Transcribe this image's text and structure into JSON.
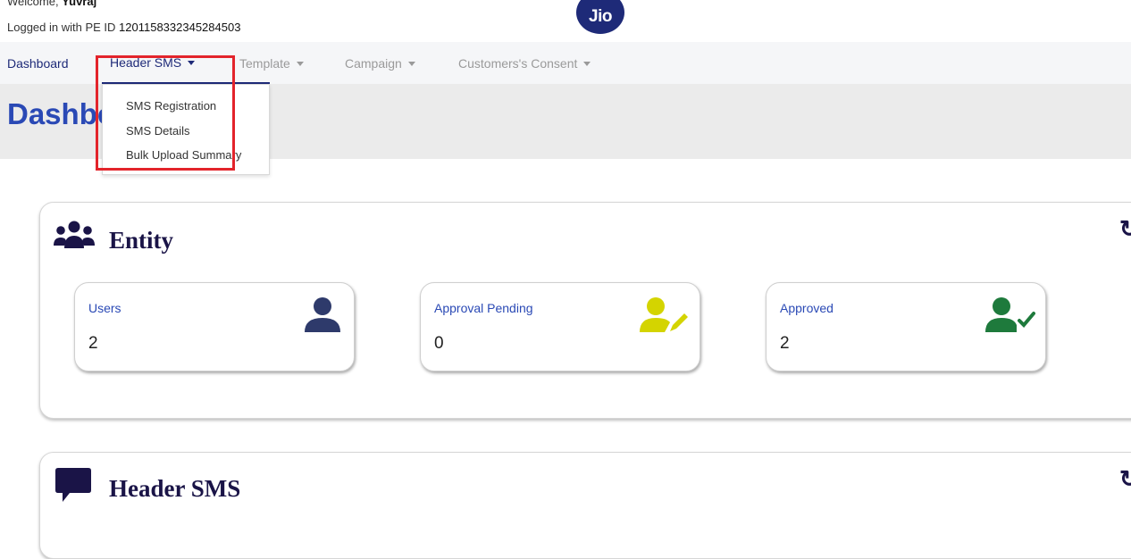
{
  "header": {
    "welcome_prefix": "Welcome, ",
    "welcome_user": "Yuvraj",
    "pe_prefix": "Logged in with PE ID ",
    "pe_id": "1201158332345284503",
    "logo_text": "Jio"
  },
  "nav": {
    "items": [
      {
        "label": "Dashboard"
      },
      {
        "label": "Header SMS"
      },
      {
        "label": "Template"
      },
      {
        "label": "Campaign"
      },
      {
        "label": "Customers's Consent"
      }
    ]
  },
  "dropdown": {
    "items": [
      {
        "label": "SMS Registration"
      },
      {
        "label": "SMS Details"
      },
      {
        "label": "Bulk Upload Summary"
      }
    ]
  },
  "page": {
    "title": "Dashboard"
  },
  "sections": {
    "entity": {
      "title": "Entity",
      "stats": [
        {
          "label": "Users",
          "value": "2",
          "icon": "user-icon",
          "color": "#2e3a6b"
        },
        {
          "label": "Approval Pending",
          "value": "0",
          "icon": "user-edit-icon",
          "color": "#d4d400"
        },
        {
          "label": "Approved",
          "value": "2",
          "icon": "user-check-icon",
          "color": "#1e7a3c"
        }
      ]
    },
    "header_sms": {
      "title": "Header SMS"
    }
  },
  "colors": {
    "brand": "#1e2a78",
    "accent_blue": "#2a49b5",
    "highlight_red": "#e3242b"
  }
}
